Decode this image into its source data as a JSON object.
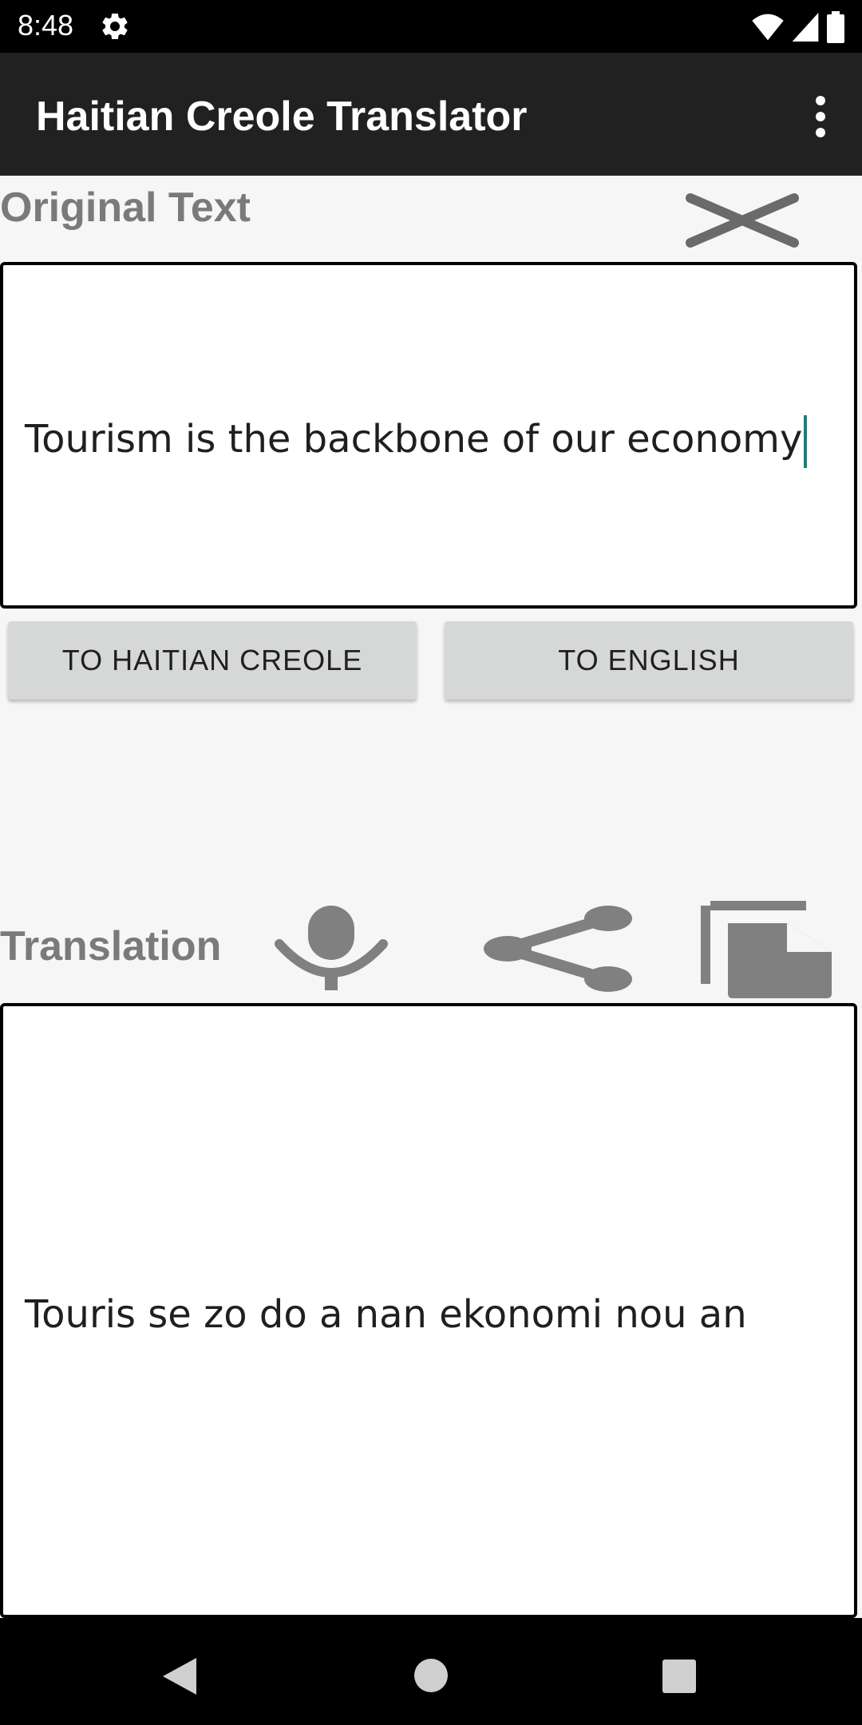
{
  "status_bar": {
    "time": "8:48",
    "icons": [
      "settings-icon",
      "wifi-icon",
      "signal-icon",
      "battery-icon"
    ]
  },
  "app_bar": {
    "title": "Haitian Creole Translator",
    "menu_icon": "more-vert-icon"
  },
  "original": {
    "label": "Original Text",
    "text": "Tourism is the backbone of our economy",
    "clear_icon": "close-icon"
  },
  "buttons": {
    "to_creole": "TO HAITIAN CREOLE",
    "to_english": "TO ENGLISH"
  },
  "translation": {
    "label": "Translation",
    "text": "Touris se zo do a nan ekonomi nou an",
    "icons": [
      "microphone-icon",
      "share-icon",
      "copy-icon"
    ]
  },
  "nav_bar": {
    "icons": [
      "back-icon",
      "home-icon",
      "recents-icon"
    ]
  },
  "colors": {
    "app_bar": "#212121",
    "label_gray": "#7a7a7a",
    "icon_gray": "#808080",
    "button_bg": "#d6d7d7",
    "caret": "#15817a"
  }
}
